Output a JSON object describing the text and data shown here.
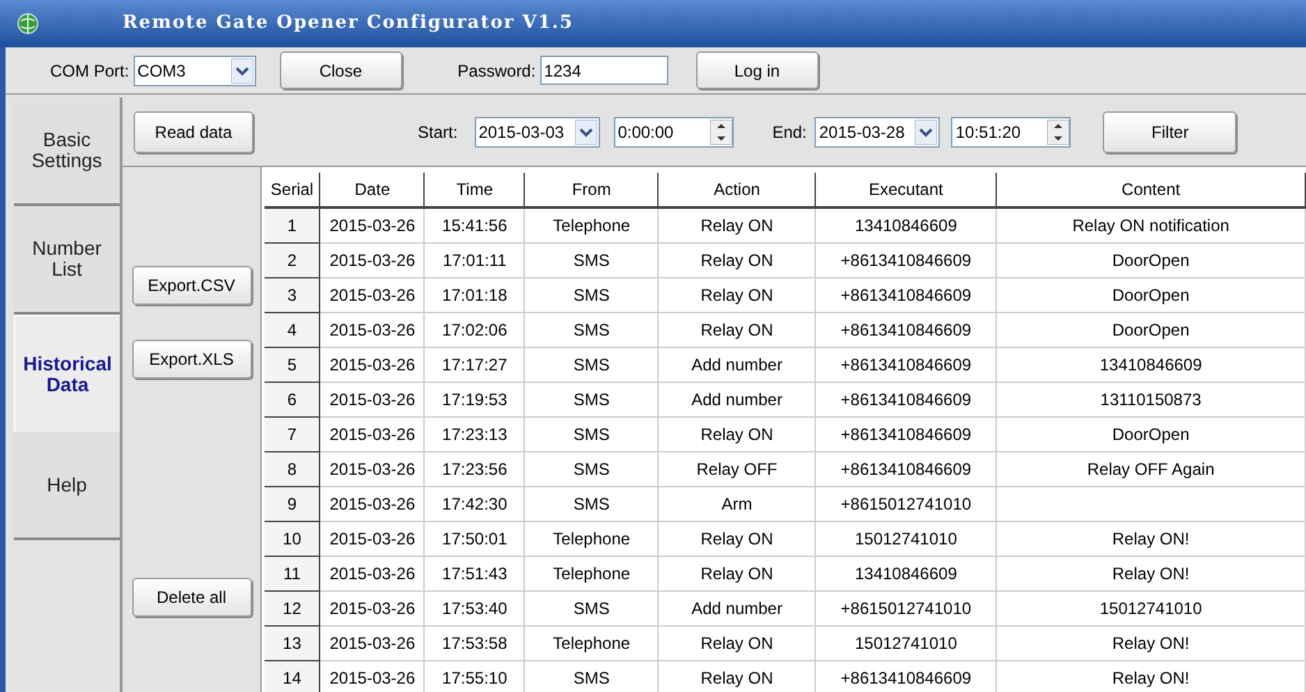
{
  "window": {
    "title": "Remote Gate Opener Configurator V1.5"
  },
  "toolbar": {
    "com_port_label": "COM Port:",
    "com_port": "COM3",
    "close_button": "Close",
    "password_label": "Password:",
    "password": "1234",
    "login_button": "Log in"
  },
  "tabs": [
    {
      "label": "Basic Settings",
      "selected": false
    },
    {
      "label": "Number List",
      "selected": false
    },
    {
      "label": "Historical Data",
      "selected": true
    },
    {
      "label": "Help",
      "selected": false
    }
  ],
  "actions": {
    "read_data": "Read data",
    "export_csv": "Export.CSV",
    "export_xls": "Export.XLS",
    "delete_all": "Delete all"
  },
  "filter": {
    "start_label": "Start:",
    "start_date": "2015-03-03",
    "start_time": "0:00:00",
    "end_label": "End:",
    "end_date": "2015-03-28",
    "end_time": "10:51:20",
    "filter_button": "Filter"
  },
  "table": {
    "columns": [
      "Serial",
      "Date",
      "Time",
      "From",
      "Action",
      "Executant",
      "Content"
    ],
    "rows": [
      [
        "1",
        "2015-03-26",
        "15:41:56",
        "Telephone",
        "Relay ON",
        "13410846609",
        "Relay ON notification"
      ],
      [
        "2",
        "2015-03-26",
        "17:01:11",
        "SMS",
        "Relay ON",
        "+8613410846609",
        "DoorOpen"
      ],
      [
        "3",
        "2015-03-26",
        "17:01:18",
        "SMS",
        "Relay ON",
        "+8613410846609",
        "DoorOpen"
      ],
      [
        "4",
        "2015-03-26",
        "17:02:06",
        "SMS",
        "Relay ON",
        "+8613410846609",
        "DoorOpen"
      ],
      [
        "5",
        "2015-03-26",
        "17:17:27",
        "SMS",
        "Add number",
        "+8613410846609",
        "13410846609"
      ],
      [
        "6",
        "2015-03-26",
        "17:19:53",
        "SMS",
        "Add number",
        "+8613410846609",
        "13110150873"
      ],
      [
        "7",
        "2015-03-26",
        "17:23:13",
        "SMS",
        "Relay ON",
        "+8613410846609",
        "DoorOpen"
      ],
      [
        "8",
        "2015-03-26",
        "17:23:56",
        "SMS",
        "Relay OFF",
        "+8613410846609",
        "Relay OFF Again"
      ],
      [
        "9",
        "2015-03-26",
        "17:42:30",
        "SMS",
        "Arm",
        "+8615012741010",
        ""
      ],
      [
        "10",
        "2015-03-26",
        "17:50:01",
        "Telephone",
        "Relay ON",
        "15012741010",
        "Relay ON!"
      ],
      [
        "11",
        "2015-03-26",
        "17:51:43",
        "Telephone",
        "Relay ON",
        "13410846609",
        "Relay ON!"
      ],
      [
        "12",
        "2015-03-26",
        "17:53:40",
        "SMS",
        "Add number",
        "+8615012741010",
        "15012741010"
      ],
      [
        "13",
        "2015-03-26",
        "17:53:58",
        "Telephone",
        "Relay ON",
        "15012741010",
        "Relay ON!"
      ],
      [
        "14",
        "2015-03-26",
        "17:55:10",
        "SMS",
        "Relay ON",
        "+8613410846609",
        "Relay ON!"
      ]
    ]
  }
}
